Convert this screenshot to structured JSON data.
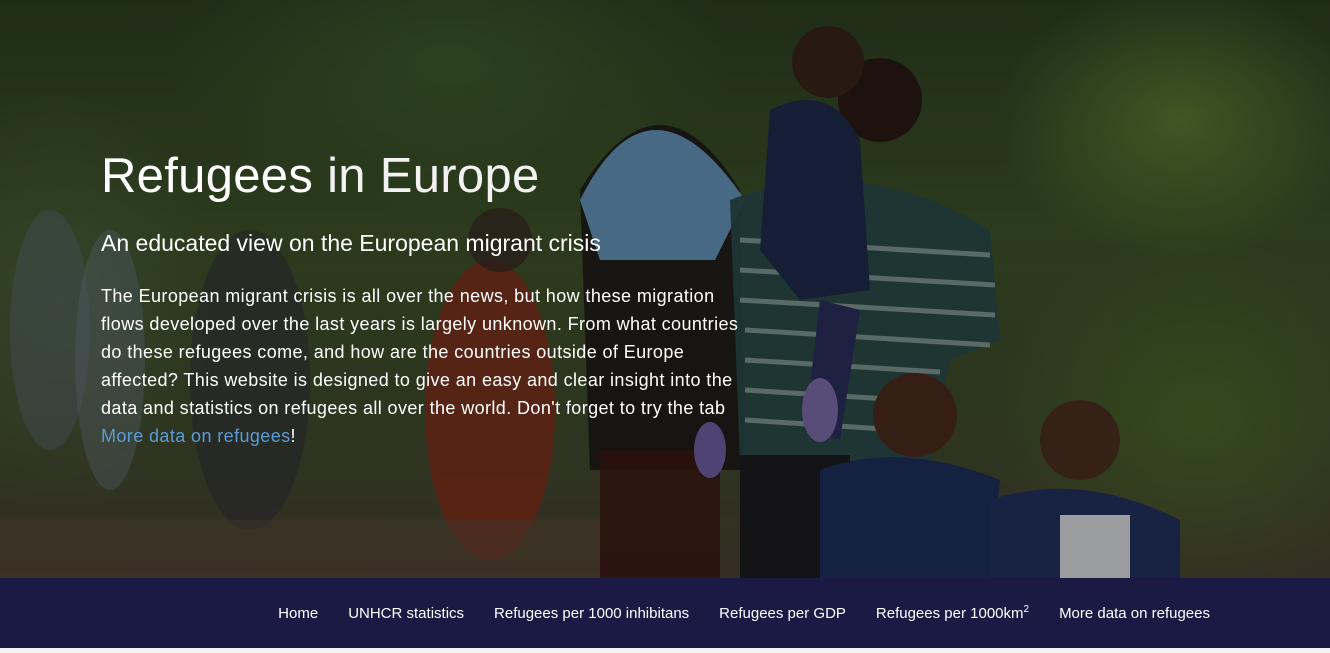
{
  "hero": {
    "image_description_icon": "family-photo",
    "title_strong": "Refugees",
    "title_light": "in Europe",
    "subtitle": "An educated view on the European migrant crisis",
    "body_text": "The European migrant crisis is all over the news, but how these migration flows developed over the last years is largely unknown. From what countries do these refugees come, and how are the countries outside of Europe affected? This website is designed to give an easy and clear insight into the data and statistics on refugees all over the world. Don't forget to try the tab ",
    "body_link": "More data on refugees",
    "body_end": "!"
  },
  "nav": {
    "items": [
      {
        "label": "Home"
      },
      {
        "label": "UNHCR statistics"
      },
      {
        "label": "Refugees per 1000 inhibitans"
      },
      {
        "label": "Refugees per GDP"
      },
      {
        "label": "Refugees per 1000km",
        "sup": "2"
      },
      {
        "label": "More data on refugees"
      }
    ]
  },
  "colors": {
    "navbar_bg": "#1b1a44",
    "link": "#5b9bd5",
    "text": "#ffffff"
  }
}
